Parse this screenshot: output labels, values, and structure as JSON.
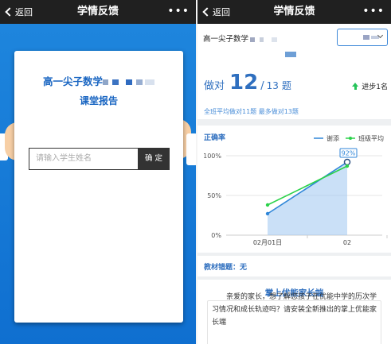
{
  "left": {
    "nav": {
      "back": "返回",
      "title": "学情反馈",
      "more": "•••"
    },
    "card": {
      "course_title": "高一尖子数学",
      "report_title": "课堂报告",
      "name_placeholder": "请输入学生姓名",
      "confirm": "确 定"
    }
  },
  "right": {
    "nav": {
      "back": "返回",
      "title": "学情反馈",
      "more": "•••"
    },
    "course": "高一尖子数学",
    "result": {
      "prefix": "做对",
      "correct": "12",
      "slash": "/",
      "total": "13",
      "suffix": "题",
      "progress": "进步1名",
      "class_stat": "全班平均做对11题  最多做对13题"
    },
    "wrong_label": "教材错题：无",
    "promo": {
      "title": "掌上优能家长端",
      "body": "亲爱的家长，想了解您孩子在优能中学的历次学习情况和成长轨迹吗？请安装全新推出的掌上优能家长端"
    }
  },
  "chart_data": {
    "type": "line",
    "title": "正确率",
    "categories": [
      "02月01日",
      "02"
    ],
    "series": [
      {
        "name": "谢添",
        "values": [
          27,
          92
        ],
        "color": "#2f86d8",
        "area": true
      },
      {
        "name": "班级平均",
        "values": [
          38,
          87
        ],
        "color": "#2bd24a"
      }
    ],
    "ylim": [
      0,
      100
    ],
    "yticks": [
      "0%",
      "50%",
      "100%"
    ],
    "data_labels": [
      "92%"
    ],
    "legend": "top-right",
    "grid": true
  },
  "colors": {
    "brand_blue": "#1a66c2",
    "left_bg": "#1f87de",
    "nav_bg": "#202020",
    "progress_green": "#27c45a"
  },
  "icons": [
    "back-chevron-icon",
    "more-icon",
    "dropdown-chevron-icon",
    "up-arrow-icon"
  ]
}
